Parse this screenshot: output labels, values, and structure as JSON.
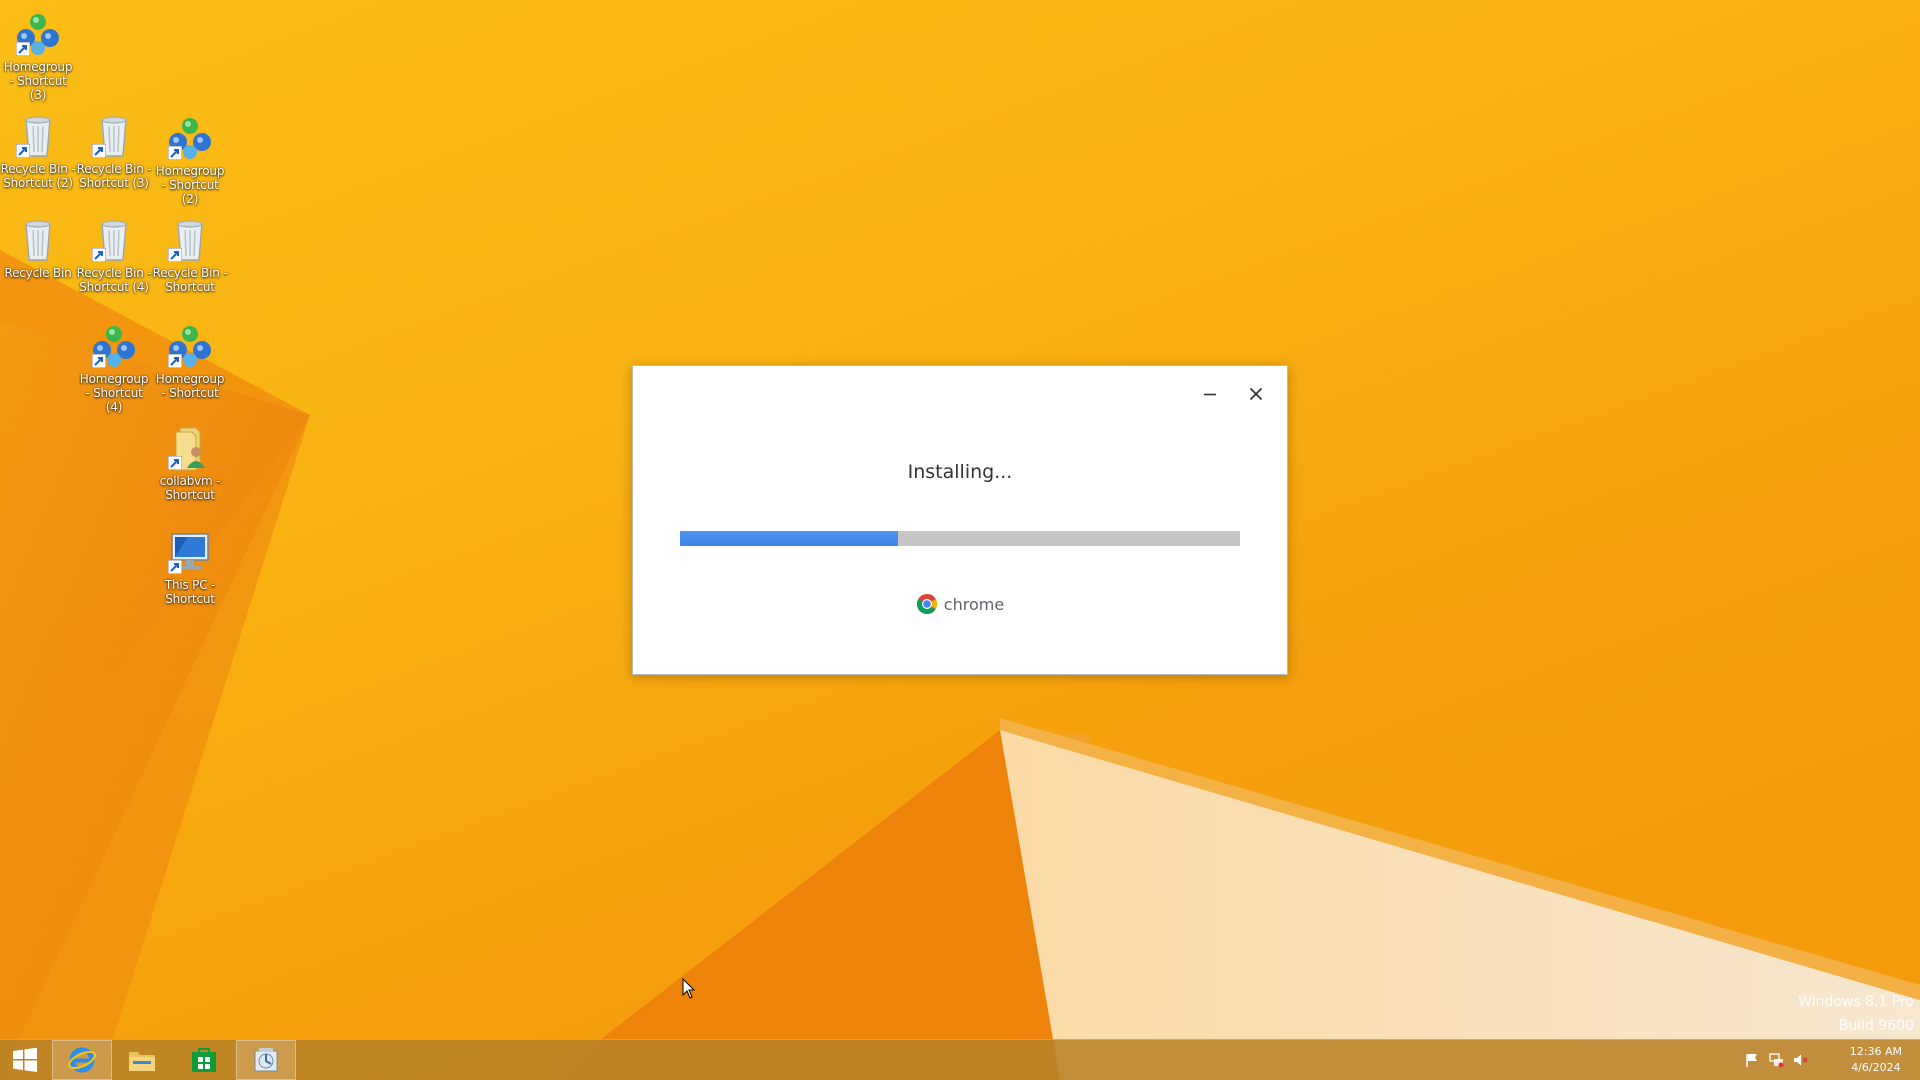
{
  "desktop_icons": [
    {
      "label_1": "Homegroup",
      "label_2": "- Shortcut (3)",
      "icon": "homegroup-icon"
    },
    {
      "label_1": "Recycle Bin -",
      "label_2": "Shortcut (2)",
      "icon": "recycle-bin-icon"
    },
    {
      "label_1": "Recycle Bin -",
      "label_2": "Shortcut (3)",
      "icon": "recycle-bin-icon"
    },
    {
      "label_1": "Homegroup",
      "label_2": "- Shortcut (2)",
      "icon": "homegroup-icon"
    },
    {
      "label_1": "Recycle Bin",
      "label_2": "",
      "icon": "recycle-bin-icon"
    },
    {
      "label_1": "Recycle Bin -",
      "label_2": "Shortcut (4)",
      "icon": "recycle-bin-icon"
    },
    {
      "label_1": "Recycle Bin -",
      "label_2": "Shortcut",
      "icon": "recycle-bin-icon"
    },
    {
      "label_1": "Homegroup",
      "label_2": "- Shortcut (4)",
      "icon": "homegroup-icon"
    },
    {
      "label_1": "Homegroup",
      "label_2": "- Shortcut",
      "icon": "homegroup-icon"
    },
    {
      "label_1": "collabvm -",
      "label_2": "Shortcut",
      "icon": "user-folder-icon"
    },
    {
      "label_1": "This PC -",
      "label_2": "Shortcut",
      "icon": "this-pc-icon"
    }
  ],
  "installer": {
    "status": "Installing...",
    "progress": 0.39,
    "brand": "chrome",
    "minimize_icon": "minimize-icon",
    "close_icon": "close-icon",
    "accent_color": "#3b82e6"
  },
  "watermark": {
    "line1": "Windows 8.1 Pro",
    "line2": "Build 9600"
  },
  "taskbar": {
    "items": [
      "start-icon",
      "internet-explorer-icon",
      "file-explorer-icon",
      "store-icon",
      "chrome-installer-icon"
    ],
    "tray_icons": [
      "action-center-flag-icon",
      "network-icon",
      "volume-muted-icon"
    ],
    "time": "12:36 AM",
    "date": "4/6/2024"
  }
}
